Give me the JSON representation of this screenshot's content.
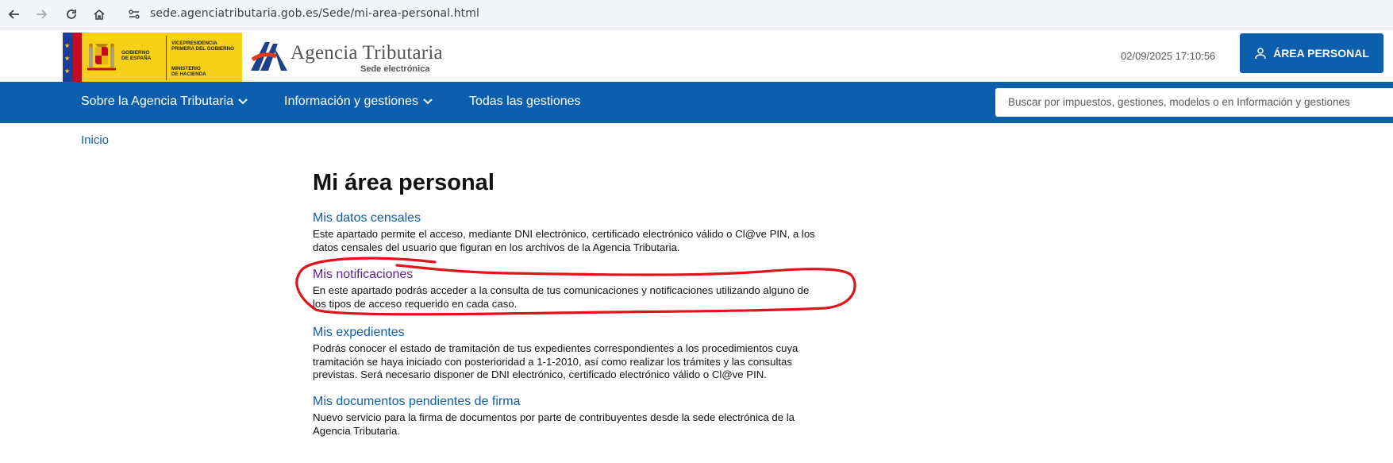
{
  "browser": {
    "url": "sede.agenciatributaria.gob.es/Sede/mi-area-personal.html",
    "icons": [
      "back-icon",
      "forward-icon",
      "reload-icon",
      "home-icon",
      "site-info-icon"
    ]
  },
  "header": {
    "gov_line1": "GOBIERNO",
    "gov_line2": "DE ESPAÑA",
    "vice_line1": "VICEPRESIDENCIA",
    "vice_line2": "PRIMERA DEL GOBIERNO",
    "min_line1": "MINISTERIO",
    "min_line2": "DE HACIENDA",
    "agency_name": "Agencia Tributaria",
    "agency_sub": "Sede electrónica",
    "datetime": "02/09/2025 17:10:56",
    "area_button": "ÁREA PERSONAL"
  },
  "nav": {
    "items": [
      {
        "label": "Sobre la Agencia Tributaria"
      },
      {
        "label": "Información y gestiones"
      },
      {
        "label": "Todas las gestiones"
      }
    ],
    "search_placeholder": "Buscar por impuestos, gestiones, modelos o en Información y gestiones"
  },
  "breadcrumb": "Inicio",
  "main": {
    "title": "Mi área personal",
    "sections": [
      {
        "link": "Mis datos censales",
        "desc": "Este apartado permite el acceso, mediante DNI electrónico, certificado electrónico válido o Cl@ve PIN, a los datos censales del usuario que figuran en los archivos de la Agencia Tributaria."
      },
      {
        "link": "Mis notificaciones",
        "desc": "En este apartado podrás acceder a la consulta de tus comunicaciones y notificaciones utilizando alguno de los tipos de acceso requerido en cada caso."
      },
      {
        "link": "Mis expedientes",
        "desc": "Podrás conocer el estado de tramitación de tus expedientes correspondientes a los procedimientos cuya tramitación se haya iniciado con posterioridad a 1-1-2010, así como realizar los trámites y las consultas previstas. Será necesario disponer de DNI electrónico, certificado electrónico válido o Cl@ve PIN."
      },
      {
        "link": "Mis documentos pendientes de firma",
        "desc": "Nuevo servicio para la firma de documentos por parte de contribuyentes desde la sede electrónica de la Agencia Tributaria."
      }
    ]
  },
  "colors": {
    "brand_blue": "#0d5fae",
    "visited_link": "#5b1e9c",
    "annotation_red": "#e0141c"
  }
}
